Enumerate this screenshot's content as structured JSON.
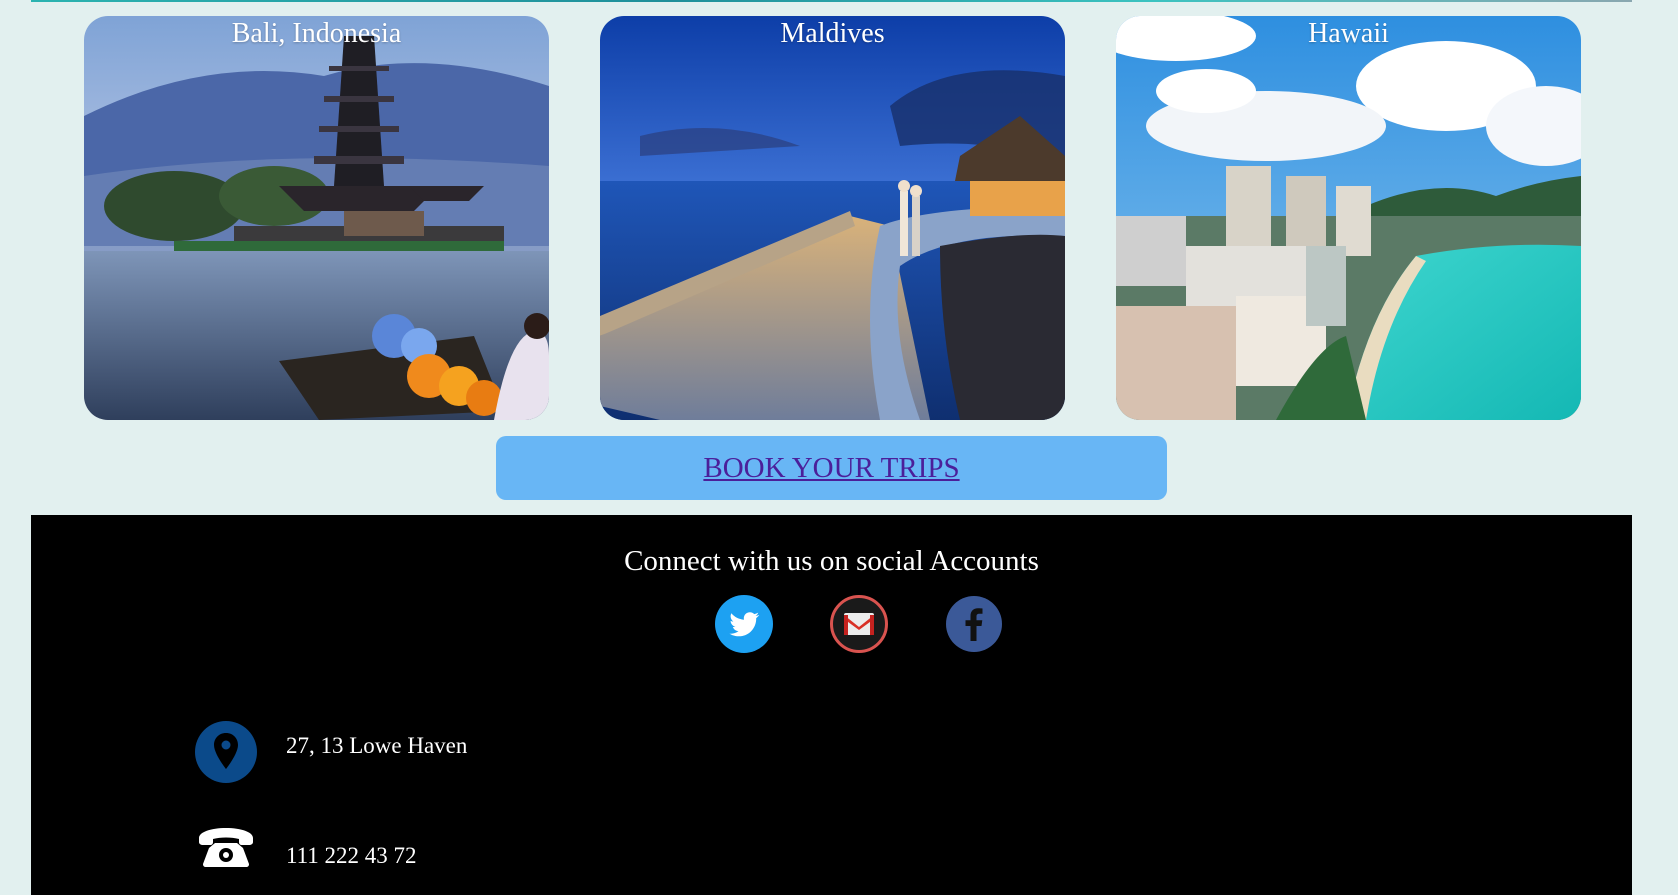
{
  "gallery": {
    "cards": [
      {
        "label": "Bali, Indonesia"
      },
      {
        "label": "Maldives"
      },
      {
        "label": "Hawaii"
      }
    ]
  },
  "cta": {
    "label": "BOOK YOUR TRIPS"
  },
  "footer": {
    "title": "Connect with us on social Accounts",
    "social": [
      "twitter-icon",
      "gmail-icon",
      "facebook-icon"
    ],
    "address": "27, 13 Lowe Haven",
    "phone": "111 222 43 72"
  },
  "colors": {
    "page_bg": "#e2f0ef",
    "button_bg": "#68b6f5",
    "link": "#4b1f9a",
    "footer_bg": "#000000"
  }
}
